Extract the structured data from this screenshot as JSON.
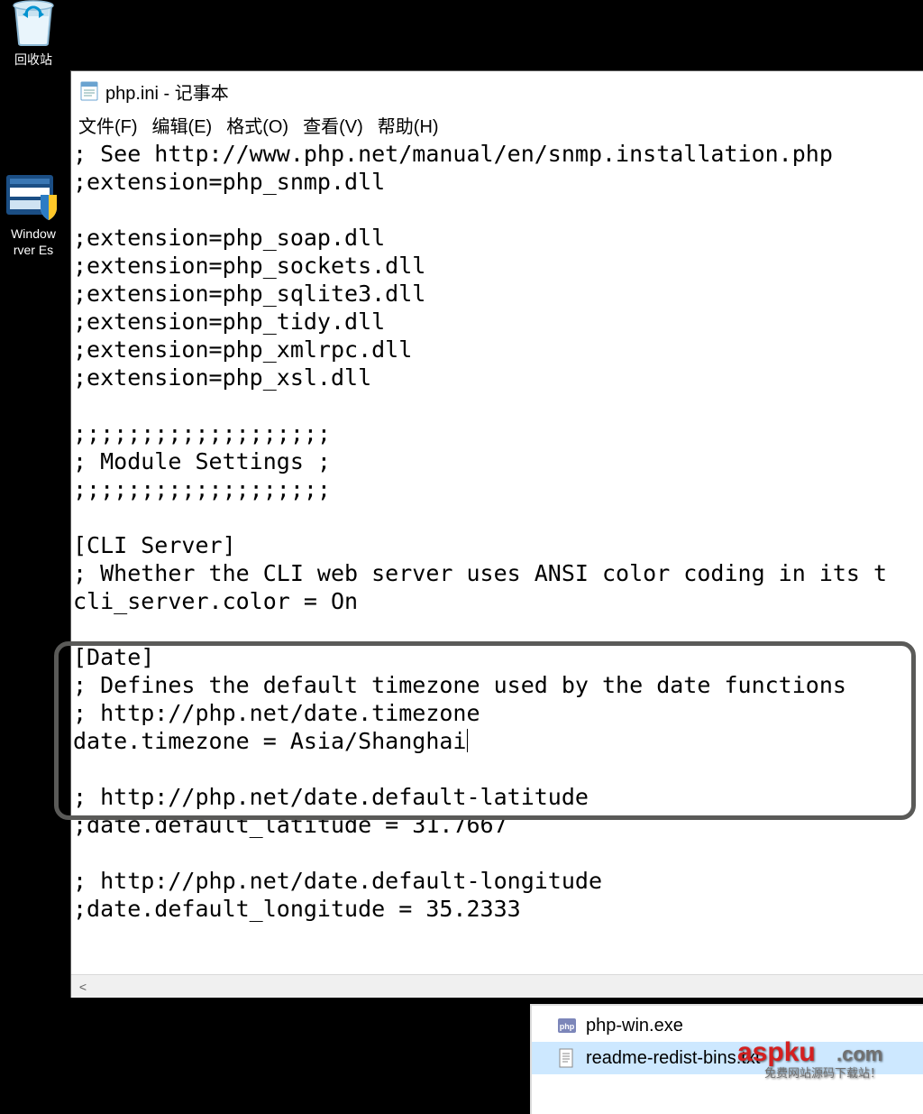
{
  "desktop": {
    "recycle_bin_label": "回收站",
    "defender_line1": "Window",
    "defender_line2": "rver Es"
  },
  "notepad": {
    "title": "php.ini - 记事本",
    "menu": {
      "file": "文件(F)",
      "edit": "编辑(E)",
      "format": "格式(O)",
      "view": "查看(V)",
      "help": "帮助(H)"
    },
    "content_before": "; See http://www.php.net/manual/en/snmp.installation.php\n;extension=php_snmp.dll\n\n;extension=php_soap.dll\n;extension=php_sockets.dll\n;extension=php_sqlite3.dll\n;extension=php_tidy.dll\n;extension=php_xmlrpc.dll\n;extension=php_xsl.dll\n\n;;;;;;;;;;;;;;;;;;;\n; Module Settings ;\n;;;;;;;;;;;;;;;;;;;\n\n[CLI Server]\n; Whether the CLI web server uses ANSI color coding in its t\ncli_server.color = On\n\n[Date]\n; Defines the default timezone used by the date functions\n; http://php.net/date.timezone\ndate.timezone = Asia/Shanghai",
    "content_after": "\n\n; http://php.net/date.default-latitude\n;date.default_latitude = 31.7667\n\n; http://php.net/date.default-longitude\n;date.default_longitude = 35.2333\n",
    "scroll_arrow": "<"
  },
  "files": {
    "items": [
      {
        "name": "php-win.exe",
        "icon": "php",
        "selected": false
      },
      {
        "name": "readme-redist-bins.txt",
        "icon": "txt",
        "selected": true
      }
    ]
  },
  "watermark": {
    "brand": "aspku",
    "tld": ".com",
    "sub": "免费网站源码下载站！"
  }
}
